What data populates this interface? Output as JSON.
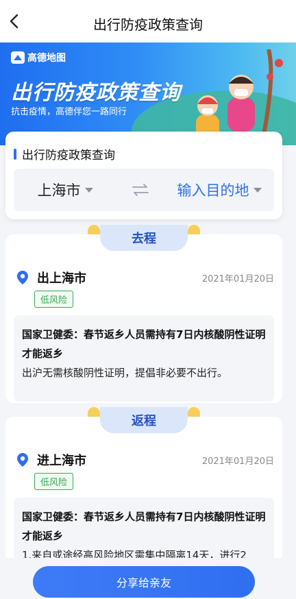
{
  "header": {
    "title": "出行防疫政策查询",
    "back_icon": "chevron-left-icon"
  },
  "banner": {
    "logo_text": "高德地图",
    "headline": "出行防疫政策查询",
    "slogan": "抗击疫情，高德伴您一路同行"
  },
  "search": {
    "section_title": "出行防疫政策查询",
    "from_city": "上海市",
    "to_placeholder": "输入目的地",
    "swap_icon": "swap-arrows-icon"
  },
  "departure": {
    "tab_label": "去程",
    "title": "出上海市",
    "date": "2021年01月20日",
    "risk_level": "低风险",
    "notice_title": "国家卫健委：春节返乡人员需持有7日内核酸阴性证明才能返乡",
    "notice_body": "出沪无需核酸阴性证明，提倡非必要不出行。"
  },
  "return": {
    "tab_label": "返程",
    "title": "进上海市",
    "date": "2021年01月20日",
    "risk_level": "低风险",
    "notice_title": "国家卫健委：春节返乡人员需持有7日内核酸阴性证明才能返乡",
    "notice_body": "1.来自或途经高风险地区需集中隔离14天，进行2"
  },
  "footer": {
    "share_label": "分享给亲友"
  },
  "colors": {
    "accent": "#2f6ff0",
    "risk_low": "#39a654",
    "pill_bg": "#dbe6fb"
  }
}
